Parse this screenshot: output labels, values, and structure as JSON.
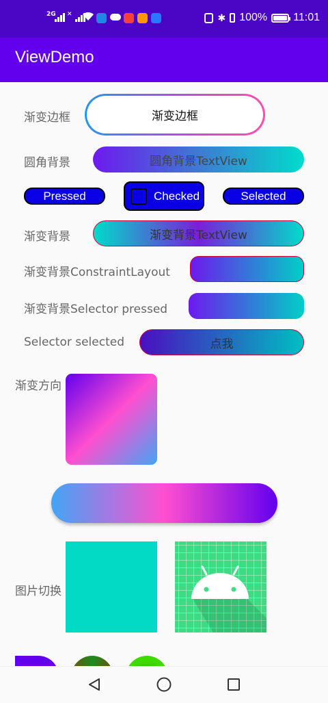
{
  "status_bar": {
    "network_left": "2G",
    "network_right": "✕",
    "battery_percent": "100%",
    "time": "11:01"
  },
  "app_bar": {
    "title": "ViewDemo"
  },
  "rows": {
    "gradient_border": {
      "label": "渐变边框",
      "text": "渐变边框"
    },
    "round_background": {
      "label": "圆角背景",
      "text": "圆角背景TextView"
    },
    "selector_buttons": {
      "pressed": "Pressed",
      "checked": "Checked",
      "selected": "Selected"
    },
    "gradient_background": {
      "label": "渐变背景",
      "text": "渐变背景TextView"
    },
    "gradient_constraint": {
      "label": "渐变背景ConstraintLayout"
    },
    "gradient_selector_pressed": {
      "label": "渐变背景Selector pressed"
    },
    "selector_selected": {
      "label": "Selector selected",
      "text": "点我"
    },
    "gradient_direction": {
      "label": "渐变方向"
    },
    "image_switch": {
      "label": "图片切换"
    }
  },
  "colors": {
    "status_bar": "#4a06c4",
    "app_bar": "#6200ee",
    "selector_blue": "#0a00e6",
    "teal": "#03dac5",
    "android_green": "#3ddc84"
  }
}
